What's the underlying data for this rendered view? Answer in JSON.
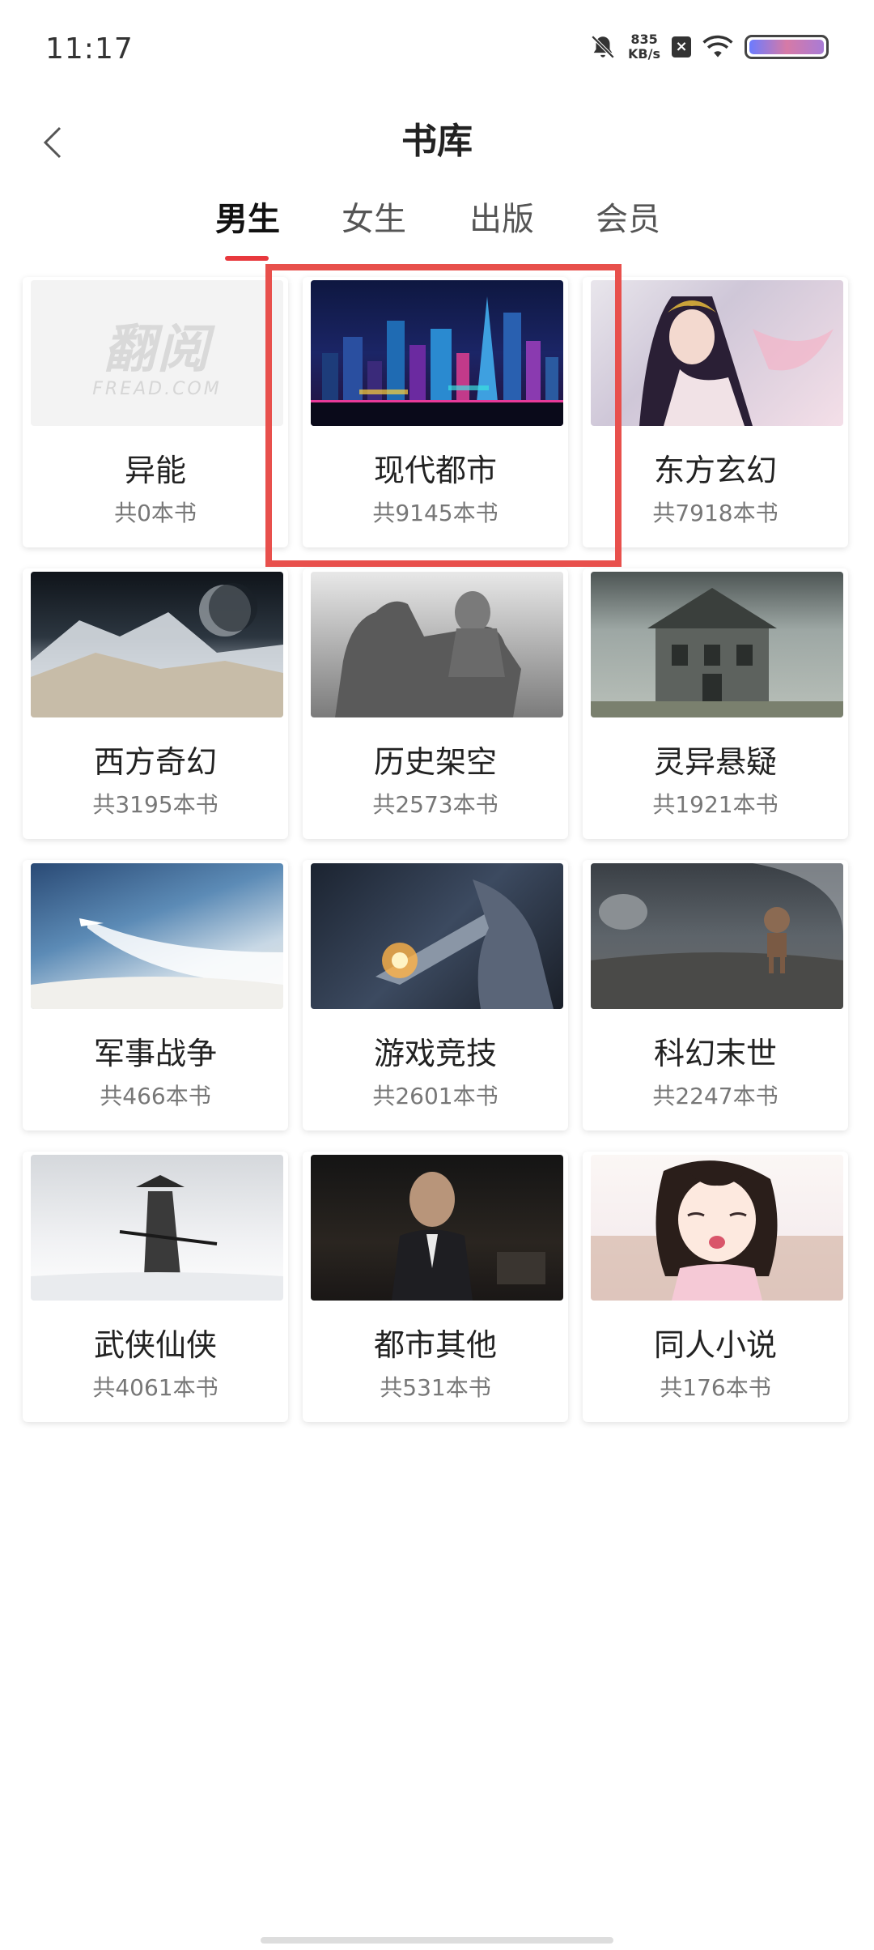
{
  "status_bar": {
    "time": "11:17",
    "net_speed_value": "835",
    "net_speed_unit": "KB/s"
  },
  "nav": {
    "title": "书库"
  },
  "tabs": [
    {
      "label": "男生",
      "active": true
    },
    {
      "label": "女生",
      "active": false
    },
    {
      "label": "出版",
      "active": false
    },
    {
      "label": "会员",
      "active": false
    }
  ],
  "categories": [
    {
      "name": "异能",
      "count": "共0本书",
      "image": "fread-logo-placeholder",
      "logo_text": "翻阅",
      "logo_sub": "FREAD.COM"
    },
    {
      "name": "现代都市",
      "count": "共9145本书",
      "image": "neon-city-skyline"
    },
    {
      "name": "东方玄幻",
      "count": "共7918本书",
      "image": "fantasy-woman-portrait"
    },
    {
      "name": "西方奇幻",
      "count": "共3195本书",
      "image": "mountain-planet-landscape"
    },
    {
      "name": "历史架空",
      "count": "共2573本书",
      "image": "equestrian-statue"
    },
    {
      "name": "灵异悬疑",
      "count": "共1921本书",
      "image": "haunted-house"
    },
    {
      "name": "军事战争",
      "count": "共466本书",
      "image": "jet-above-clouds"
    },
    {
      "name": "游戏竞技",
      "count": "共2601本书",
      "image": "mecha-battle"
    },
    {
      "name": "科幻末世",
      "count": "共2247本书",
      "image": "robot-on-moon"
    },
    {
      "name": "武侠仙侠",
      "count": "共4061本书",
      "image": "swordsman-in-snow"
    },
    {
      "name": "都市其他",
      "count": "共531本书",
      "image": "man-in-suit"
    },
    {
      "name": "同人小说",
      "count": "共176本书",
      "image": "anime-girl"
    }
  ],
  "colors": {
    "accent": "#e8383d",
    "highlight": "#e8504c"
  }
}
